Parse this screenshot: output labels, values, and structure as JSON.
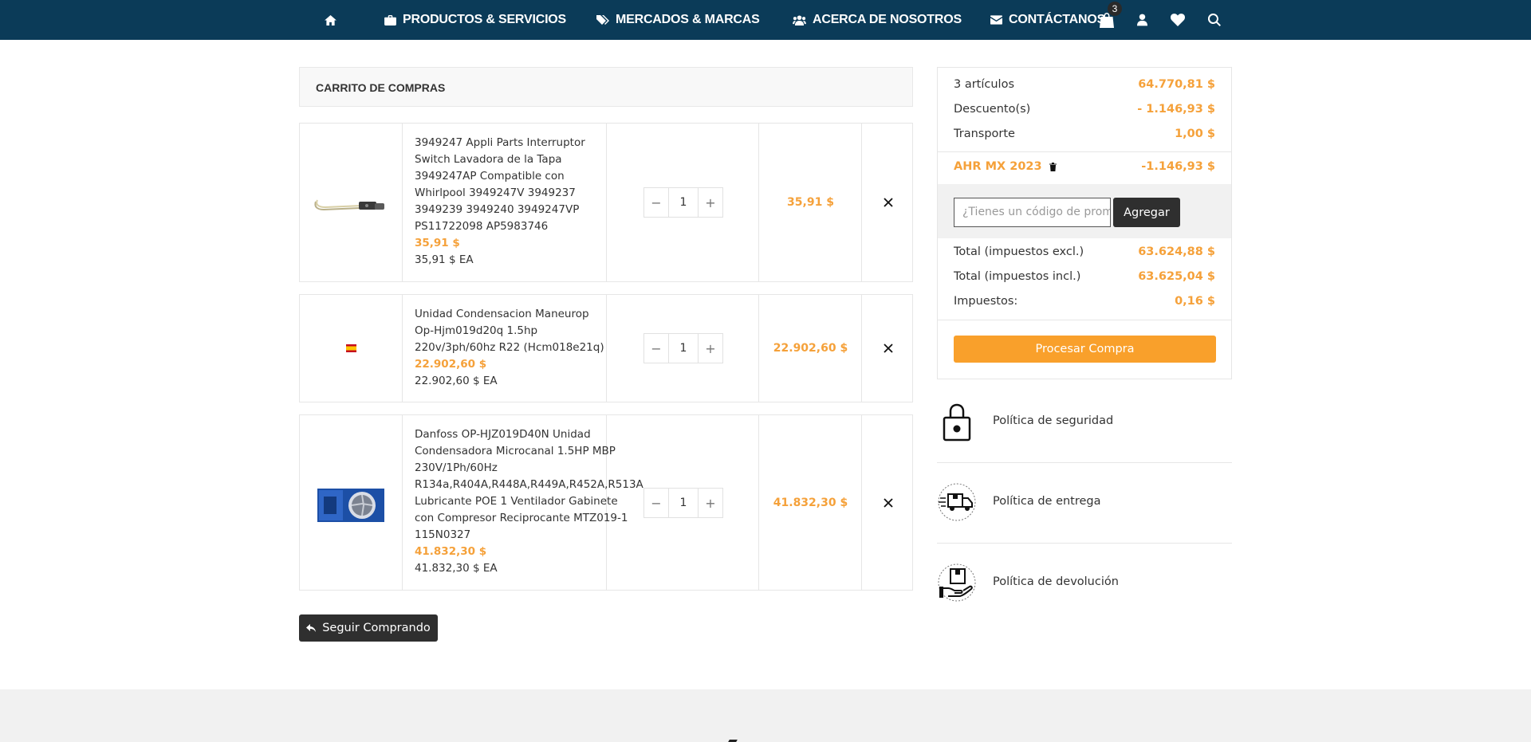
{
  "nav": {
    "home_icon": "home-icon",
    "items": [
      {
        "label": "PRODUCTOS & SERVICIOS",
        "icon": "briefcase-icon"
      },
      {
        "label": "MERCADOS & MARCAS",
        "icon": "tags-icon"
      },
      {
        "label": "ACERCA DE NOSOTROS",
        "icon": "users-icon"
      },
      {
        "label": "CONTÁCTANOS",
        "icon": "envelope-icon"
      }
    ],
    "cart_count": "3",
    "bg_color": "#0b3b58"
  },
  "cart": {
    "title": "CARRITO DE COMPRAS",
    "items": [
      {
        "name": "3949247 Appli Parts Interruptor Switch Lavadora de la Tapa 3949247AP Compatible con Whirlpool 3949247V 3949237 3949239 3949240 3949247VP PS11722098 AP5983746",
        "price": "35,91 $",
        "unit": "35,91 $ EA",
        "qty": "1",
        "total": "35,91 $"
      },
      {
        "name": "Unidad Condensacion Maneurop Op-Hjm019d20q 1.5hp 220v/3ph/60hz R22 (Hcm018e21q)",
        "price": "22.902,60 $",
        "unit": "22.902,60 $ EA",
        "qty": "1",
        "total": "22.902,60 $"
      },
      {
        "name": "Danfoss OP-HJZ019D40N Unidad Condensadora Microcanal 1.5HP MBP 230V/1Ph/60Hz R134a,R404A,R448A,R449A,R452A,R513A Lubricante POE 1 Ventilador Gabinete con Compresor Reciprocante MTZ019-1 115N0327",
        "price": "41.832,30 $",
        "unit": "41.832,30 $ EA",
        "qty": "1",
        "total": "41.832,30 $"
      }
    ],
    "continue_label": "Seguir Comprando"
  },
  "summary": {
    "items_label": "3 artículos",
    "items_value": "64.770,81 $",
    "discount_label": "Descuento(s)",
    "discount_value": "- 1.146,93 $",
    "shipping_label": "Transporte",
    "shipping_value": "1,00 $",
    "voucher_name": "AHR MX 2023",
    "voucher_value": "-1.146,93 $",
    "promo_placeholder": "¿Tienes un código de promoción?",
    "promo_button": "Agregar",
    "total_excl_label": "Total (impuestos excl.)",
    "total_excl_value": "63.624,88 $",
    "total_incl_label": "Total (impuestos incl.)",
    "total_incl_value": "63.625,04 $",
    "taxes_label": "Impuestos:",
    "taxes_value": "0,16 $",
    "checkout_label": "Procesar Compra",
    "accent_color": "#f5a13a"
  },
  "policies": [
    {
      "label": "Política de seguridad",
      "icon": "lock-icon"
    },
    {
      "label": "Política de entrega",
      "icon": "delivery-truck-icon"
    },
    {
      "label": "Política de devolución",
      "icon": "return-box-icon"
    }
  ]
}
